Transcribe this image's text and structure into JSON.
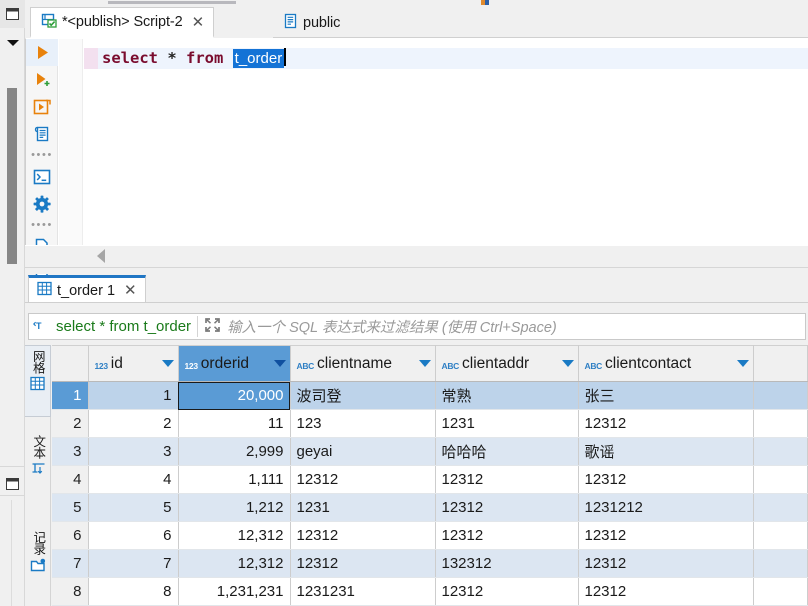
{
  "window": {
    "rail_top_icon": "restore-window-icon",
    "rail_menu_icon": "chevron-down-icon",
    "rail_bottom_icon": "restore-window-icon"
  },
  "editor_tabs": [
    {
      "label": "*<publish> Script-2",
      "icon": "sql-script-icon",
      "active": true,
      "closable": true,
      "close_label": "✕"
    },
    {
      "label": "public",
      "icon": "database-schema-icon",
      "active": false,
      "closable": false
    }
  ],
  "editor_toolbar": [
    {
      "name": "execute-sql-statement",
      "icon": "play-orange-icon"
    },
    {
      "name": "execute-sql-script",
      "icon": "play-plus-icon"
    },
    {
      "name": "execute-script-in-new-tab",
      "icon": "script-new-tab-icon"
    },
    {
      "name": "explain-execution-plan",
      "icon": "scroll-plan-icon"
    },
    {
      "name": "toolbar-overflow-1",
      "icon": "dots-icon"
    },
    {
      "name": "open-console",
      "icon": "console-icon"
    },
    {
      "name": "sql-editor-settings",
      "icon": "gear-blue-icon"
    },
    {
      "name": "toolbar-overflow-2",
      "icon": "dots-icon"
    },
    {
      "name": "export-data",
      "icon": "export-file-icon"
    },
    {
      "name": "show-errors",
      "icon": "file-error-icon"
    }
  ],
  "code": {
    "keyword_select": "select",
    "star": "*",
    "keyword_from": "from",
    "selected_identifier": "t_order",
    "full_text": "select * from t_order"
  },
  "result_tab": {
    "label": "t_order 1",
    "icon": "grid-icon",
    "close_label": "✕"
  },
  "filter": {
    "icon": "sql-text-filter-icon",
    "query": "select * from t_order",
    "expand_icon": "expand-arrows-icon",
    "placeholder": "输入一个 SQL 表达式来过滤结果 (使用 Ctrl+Space)"
  },
  "panel_tabs": [
    {
      "label": "网格",
      "icon": "grid-icon",
      "selected": true,
      "name": "panel-tab-grid"
    },
    {
      "label": "文本",
      "icon": "text-align-icon",
      "selected": false,
      "name": "panel-tab-text"
    },
    {
      "label": "记录",
      "icon": "record-icon",
      "selected": false,
      "name": "panel-tab-record"
    }
  ],
  "grid": {
    "row_header": "",
    "columns": [
      {
        "name": "id",
        "type_icon": "123",
        "key": true,
        "selected": false,
        "align": "right"
      },
      {
        "name": "orderid",
        "type_icon": "123",
        "key": false,
        "selected": true,
        "align": "right"
      },
      {
        "name": "clientname",
        "type_icon": "ABC",
        "key": false,
        "selected": false,
        "align": "left"
      },
      {
        "name": "clientaddr",
        "type_icon": "ABC",
        "key": false,
        "selected": false,
        "align": "left"
      },
      {
        "name": "clientcontact",
        "type_icon": "ABC",
        "key": false,
        "selected": false,
        "align": "left"
      }
    ],
    "rows": [
      {
        "n": "1",
        "cells": [
          "1",
          "20,000",
          "波司登",
          "常熟",
          "张三"
        ]
      },
      {
        "n": "2",
        "cells": [
          "2",
          "11",
          "123",
          "1231",
          "12312"
        ]
      },
      {
        "n": "3",
        "cells": [
          "3",
          "2,999",
          "geyai",
          "哈哈哈",
          "歌谣"
        ]
      },
      {
        "n": "4",
        "cells": [
          "4",
          "1,111",
          "12312",
          "12312",
          "12312"
        ]
      },
      {
        "n": "5",
        "cells": [
          "5",
          "1,212",
          "1231",
          "12312",
          "1231212"
        ]
      },
      {
        "n": "6",
        "cells": [
          "6",
          "12,312",
          "12312",
          "12312",
          "12312"
        ]
      },
      {
        "n": "7",
        "cells": [
          "7",
          "12,312",
          "12312",
          "132312",
          "12312"
        ]
      },
      {
        "n": "8",
        "cells": [
          "8",
          "1,231,231",
          "1231231",
          "12312",
          "12312"
        ]
      }
    ],
    "selected_row_index": 0,
    "selected_cell_col": 1
  },
  "colors": {
    "accent_blue": "#1a7ac4",
    "selection_blue": "#5a9bd5",
    "row_selected": "#bdd3ea",
    "row_alt": "#dce6f2",
    "token_selection": "#1473d6",
    "keyword": "#7a0c2e",
    "filter_query": "#1a7a1a",
    "tab_underline": "#2076c4",
    "toolbar_orange": "#e8820c"
  }
}
